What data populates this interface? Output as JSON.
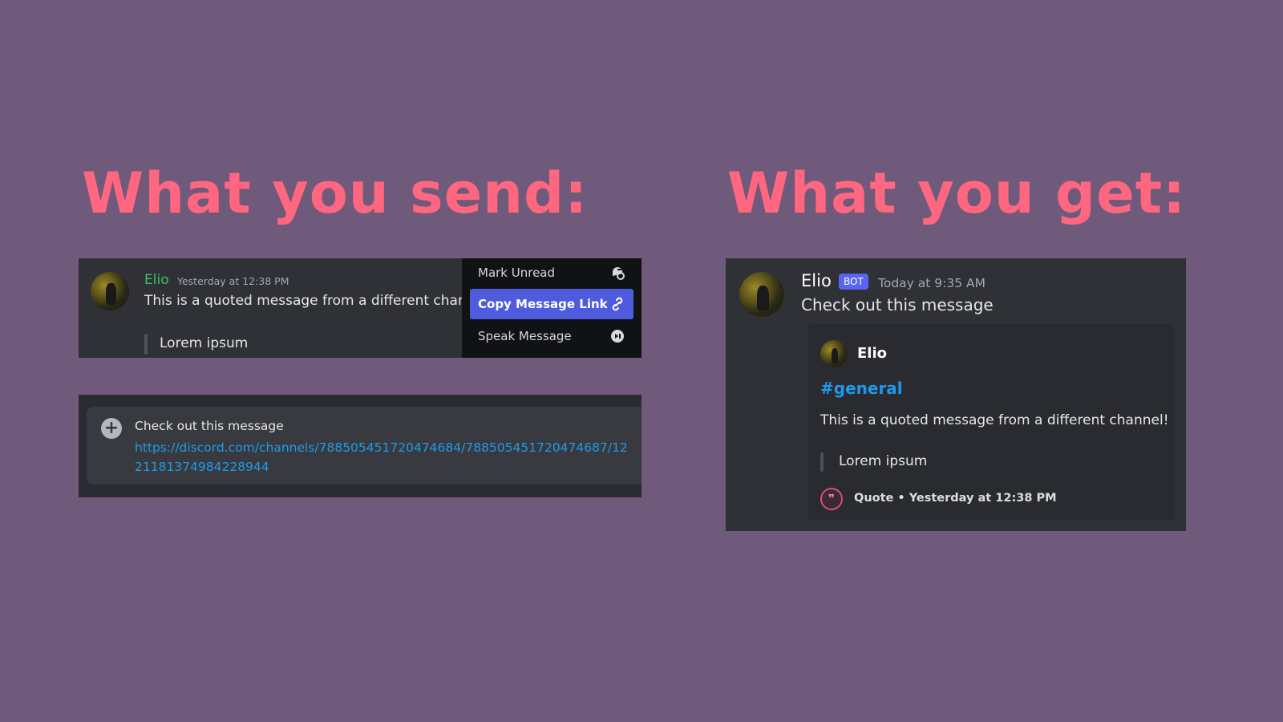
{
  "headings": {
    "left": "What you send:",
    "right": "What you get:"
  },
  "send_message": {
    "username": "Elio",
    "timestamp": "Yesterday at 12:38 PM",
    "text": "This is a quoted message from a different channe",
    "quote": "Lorem ipsum"
  },
  "context_menu": {
    "items": [
      {
        "label": "Mark Unread",
        "icon": "mark-unread-icon"
      },
      {
        "label": "Copy Message Link",
        "icon": "link-icon",
        "active": true
      },
      {
        "label": "Speak Message",
        "icon": "speak-icon"
      }
    ]
  },
  "composer": {
    "text": "Check out this message",
    "link": "https://discord.com/channels/788505451720474684/788505451720474687/1221181374984228944"
  },
  "result_message": {
    "username": "Elio",
    "badge": "BOT",
    "timestamp": "Today at 9:35 AM",
    "text": "Check out this message",
    "embed": {
      "author": "Elio",
      "channel": "#general",
      "description": "This is a quoted message from a different channel!",
      "quote": "Lorem ipsum",
      "footer_icon": "quote-icon",
      "footer": "Quote • Yesterday at 12:38 PM"
    }
  },
  "colors": {
    "background": "#6f5a7b",
    "heading": "#ff6680",
    "accent": "#5865f2",
    "link": "#1f9ae8",
    "username_green": "#3ec26a"
  }
}
